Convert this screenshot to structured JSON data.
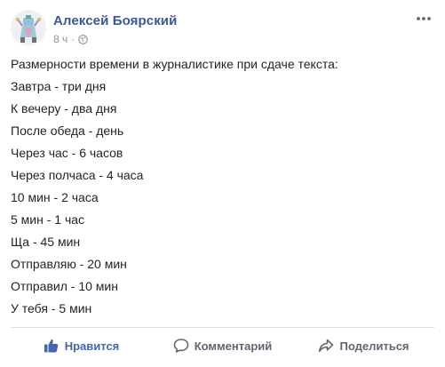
{
  "post": {
    "author": "Алексей Боярский",
    "time": "8 ч",
    "separator": "·",
    "lines": [
      "Размерности времени в журналистике при сдаче текста:",
      "Завтра - три дня",
      "К вечеру - два дня",
      "После обеда - день",
      "Через час - 6 часов",
      "Через полчаса - 4 часа",
      "10 мин - 2 часа",
      "5 мин - 1 час",
      "Ща - 45 мин",
      "Отправляю - 20 мин",
      "Отправил - 10 мин",
      "У тебя - 5 мин"
    ]
  },
  "actions": {
    "like_label": "Нравится",
    "comment_label": "Комментарий",
    "share_label": "Поделиться"
  },
  "icons": {
    "audience": "globe-icon",
    "more": "more-options-icon",
    "like": "thumbs-up-icon",
    "comment": "comment-bubble-icon",
    "share": "share-arrow-icon"
  },
  "colors": {
    "author_link": "#385898",
    "like_active": "#4267b2",
    "meta_text": "#90949c",
    "action_text": "#606770"
  }
}
